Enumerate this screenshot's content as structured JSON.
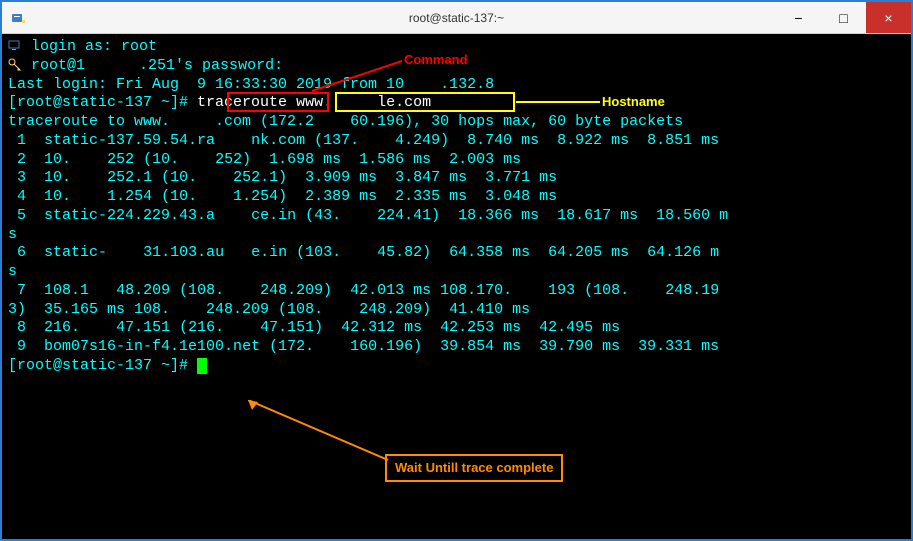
{
  "window": {
    "title": "root@static-137:~"
  },
  "buttons": {
    "min": "−",
    "max": "□",
    "close": "×"
  },
  "annotations": {
    "command": "Command",
    "hostname": "Hostname",
    "wait": "Wait Untill trace complete"
  },
  "terminal": {
    "login_as": "login as: root",
    "password_line_pre": "root@1",
    "password_line_post": ".251's password:",
    "last_login_pre": "Last login: Fri Aug  9 16:33:30 2019 from 10",
    "last_login_post": ".132.8",
    "prompt": "[root@static-137 ~]#",
    "command": "traceroute",
    "host_pre": "www.",
    "host_post": "le.com",
    "trace_head_pre": "traceroute to www.",
    "trace_head_mid": ".com (172.2",
    "trace_head_post": "60.196), 30 hops max, 60 byte packets",
    "hops": [
      {
        "n": " 1",
        "pre": "static-137.59.54.ra",
        "mid": "nk.com (137.",
        "ip2": "4.249)",
        "times": "  8.740 ms  8.922 ms  8.851 ms"
      },
      {
        "n": " 2",
        "pre": "10.",
        "b1": "252 (10.",
        "b2": "252)",
        "times": "  1.698 ms  1.586 ms  2.003 ms"
      },
      {
        "n": " 3",
        "pre": "10.",
        "b1": "252.1 (10.",
        "b2": "252.1)",
        "times": "  3.909 ms  3.847 ms  3.771 ms"
      },
      {
        "n": " 4",
        "pre": "10.",
        "b1": "1.254 (10.",
        "b2": "1.254)",
        "times": "  2.389 ms  2.335 ms  3.048 ms"
      },
      {
        "n": " 5",
        "pre": "static-224.229.43.a",
        "mid": "ce.in (43.",
        "ip2": "224.41)",
        "times": "  18.366 ms  18.617 ms  18.560 m"
      },
      {
        "wrap": "s"
      },
      {
        "n": " 6",
        "pre": "static-",
        "mid": "31.103.au",
        "mid2": "e.in (103.",
        "ip2": "45.82)",
        "times": "  64.358 ms  64.205 ms  64.126 m"
      },
      {
        "wrap": "s"
      },
      {
        "n": " 7",
        "pre": "108.1",
        "mid": "48.209 (108.",
        "ip2": "248.209)",
        "times": "  42.013 ms 108.170.",
        "tail": "193 (108.",
        "tail2": "248.19"
      },
      {
        "wrap2_pre": "3)  35.165 ms 108.",
        "wrap2_mid": "248.209 (108.",
        "wrap2_post": "248.209)  41.410 ms"
      },
      {
        "n": " 8",
        "pre": "216.",
        "mid": "47.151 (216.",
        "ip2": "47.151)",
        "times": "  42.312 ms  42.253 ms  42.495 ms"
      },
      {
        "n": " 9",
        "pre": "bom07s16-in-f4.1e100.net (172.",
        "ip2": "160.196)",
        "times": "  39.854 ms  39.790 ms  39.331 ms"
      }
    ]
  }
}
